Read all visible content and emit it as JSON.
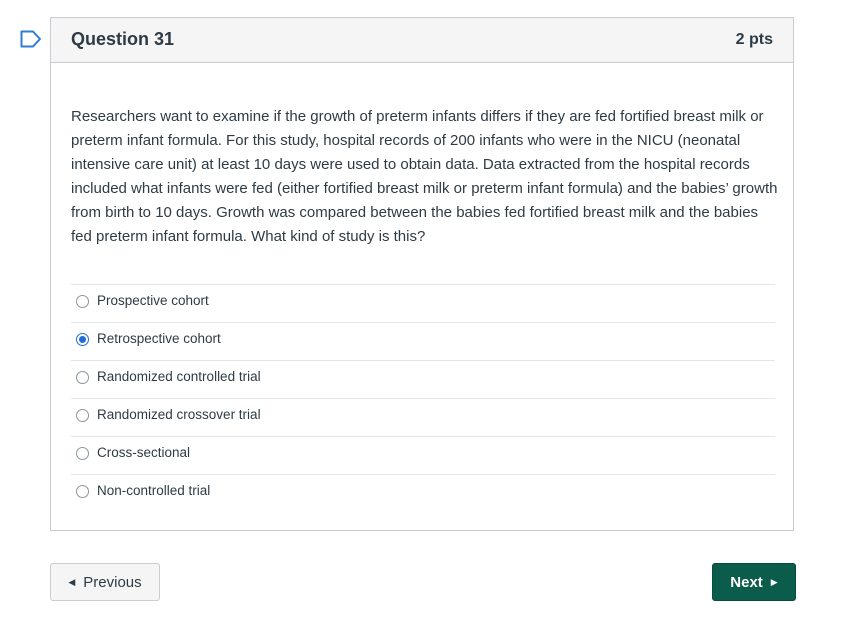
{
  "question": {
    "title": "Question 31",
    "points": "2 pts",
    "text": "Researchers want to examine if the growth of preterm infants differs if they are fed fortified breast milk or preterm infant formula.  For this study, hospital records of 200 infants who were in the NICU (neonatal intensive care unit) at least 10 days were used to obtain data.  Data extracted from the hospital records included what infants were fed (either fortified breast milk or preterm infant formula) and the babies’ growth from birth to 10 days.  Growth was compared between the babies fed fortified breast milk and the babies fed preterm infant formula.  What kind of study is this?"
  },
  "answers": [
    {
      "label": "Prospective cohort",
      "selected": false
    },
    {
      "label": "Retrospective cohort",
      "selected": true
    },
    {
      "label": "Randomized controlled trial",
      "selected": false
    },
    {
      "label": "Randomized crossover trial",
      "selected": false
    },
    {
      "label": "Cross-sectional",
      "selected": false
    },
    {
      "label": "Non-controlled trial",
      "selected": false
    }
  ],
  "nav": {
    "previous_label": "Previous",
    "next_label": "Next"
  },
  "colors": {
    "accent": "#0b5c4a",
    "selected_radio": "#1f6ed4",
    "flag": "#2d7dd2"
  },
  "icons": {
    "flag": "flag-icon",
    "prev": "caret-left-icon",
    "next": "caret-right-icon"
  }
}
